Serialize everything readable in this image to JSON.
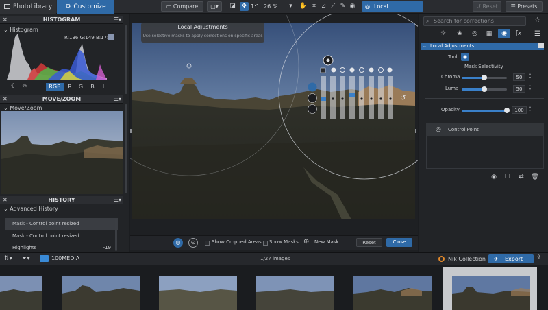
{
  "tabs": {
    "photolibrary": "PhotoLibrary",
    "customize": "Customize"
  },
  "toolbar": {
    "compare": "Compare",
    "zoom_ratio": "1:1",
    "zoom_percent": "26 %",
    "local_adjustments": "Local Adjustments",
    "reset": "Reset",
    "presets": "Presets"
  },
  "left_panel": {
    "histogram_title": "HISTOGRAM",
    "histogram_sub": "Histogram",
    "rgb_readout": "R:136 G:149 B:175",
    "channels": [
      "RGB",
      "R",
      "G",
      "B",
      "L"
    ],
    "movezoom_title": "MOVE/ZOOM",
    "movezoom_sub": "Move/Zoom",
    "history_title": "HISTORY",
    "history_sub": "Advanced History",
    "history_items": [
      {
        "label": "Mask - Control point resized"
      },
      {
        "label": "Mask - Control point resized"
      },
      {
        "label": "Highlights",
        "value": "-19"
      }
    ]
  },
  "tooltip": {
    "title": "Local Adjustments",
    "text": "Use selective masks to apply corrections on specific areas"
  },
  "center_bottom": {
    "show_cropped": "Show Cropped Areas",
    "show_masks": "Show Masks",
    "new_mask": "New Mask",
    "reset": "Reset",
    "close": "Close"
  },
  "right_panel": {
    "search_placeholder": "Search for corrections",
    "section_title": "Local Adjustments",
    "tool_label": "Tool",
    "mask_selectivity": "Mask Selectivity",
    "chroma_label": "Chroma",
    "chroma_value": "50",
    "chroma_level": 0.5,
    "luma_label": "Luma",
    "luma_value": "50",
    "luma_level": 0.5,
    "opacity_label": "Opacity",
    "opacity_value": "100",
    "opacity_level": 1.0,
    "control_point": "Control Point"
  },
  "filmstrip": {
    "folder": "100MEDIA",
    "count": "1/27 images",
    "nik": "Nik Collection",
    "export": "Export"
  },
  "colors": {
    "accent": "#2f6aa7",
    "panel": "#222427",
    "slider_fill": "#3a80c9"
  }
}
